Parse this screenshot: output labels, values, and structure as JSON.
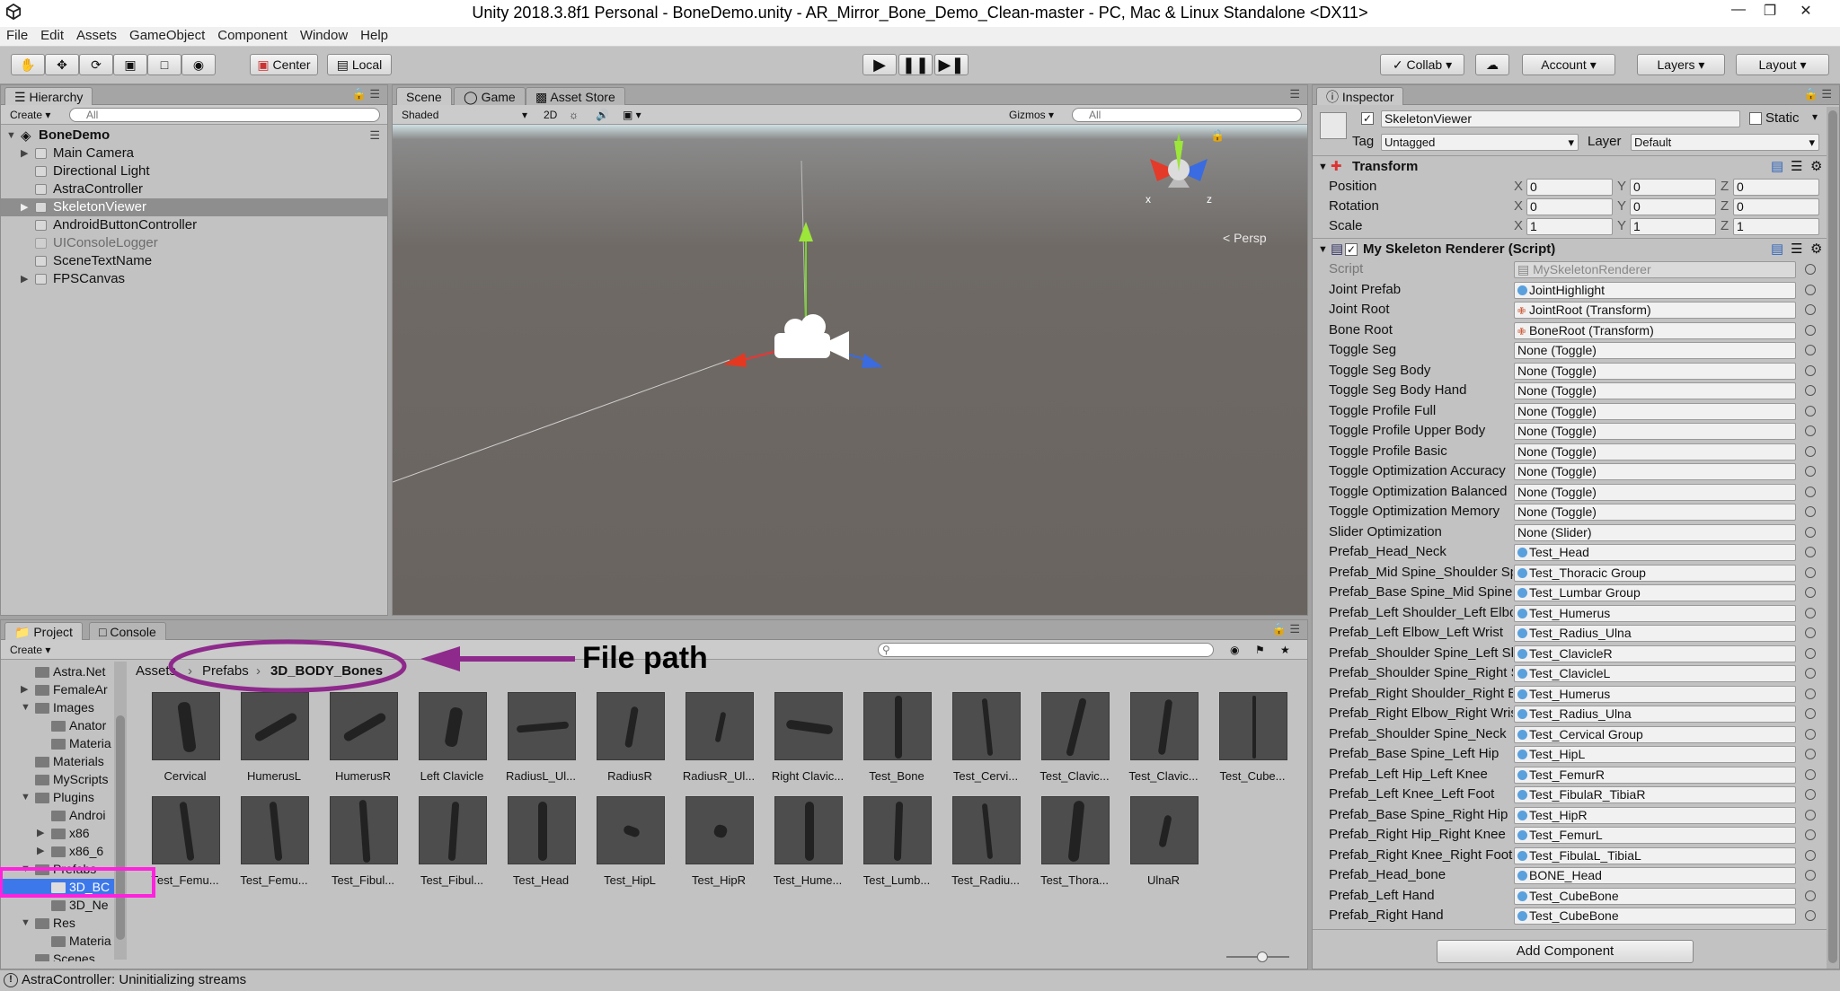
{
  "window": {
    "title": "Unity 2018.3.8f1 Personal - BoneDemo.unity - AR_Mirror_Bone_Demo_Clean-master - PC, Mac & Linux Standalone <DX11>"
  },
  "menu": [
    "File",
    "Edit",
    "Assets",
    "GameObject",
    "Component",
    "Window",
    "Help"
  ],
  "toolbar": {
    "center": "Center",
    "local": "Local",
    "collab": "Collab",
    "account": "Account",
    "layers": "Layers",
    "layout": "Layout"
  },
  "hierarchy": {
    "tab": "Hierarchy",
    "create": "Create",
    "search_placeholder": "All",
    "scene": "BoneDemo",
    "items": [
      {
        "label": "Main Camera"
      },
      {
        "label": "Directional Light"
      },
      {
        "label": "AstraController"
      },
      {
        "label": "SkeletonViewer"
      },
      {
        "label": "AndroidButtonController"
      },
      {
        "label": "UIConsoleLogger"
      },
      {
        "label": "SceneTextName"
      },
      {
        "label": "FPSCanvas"
      }
    ]
  },
  "scene": {
    "tabs": [
      "Scene",
      "Game",
      "Asset Store"
    ],
    "shading": "Shaded",
    "mode_2d": "2D",
    "gizmos": "Gizmos",
    "search_placeholder": "All",
    "persp": "Persp",
    "axis_x": "x",
    "axis_z": "z"
  },
  "inspector": {
    "tab": "Inspector",
    "object_name": "SkeletonViewer",
    "static": "Static",
    "tag_label": "Tag",
    "tag": "Untagged",
    "layer_label": "Layer",
    "layer": "Default",
    "transform": {
      "title": "Transform",
      "rows": [
        {
          "label": "Position",
          "x": "0",
          "y": "0",
          "z": "0"
        },
        {
          "label": "Rotation",
          "x": "0",
          "y": "0",
          "z": "0"
        },
        {
          "label": "Scale",
          "x": "1",
          "y": "1",
          "z": "1"
        }
      ],
      "axis_labels": [
        "X",
        "Y",
        "Z"
      ]
    },
    "script_component": {
      "title": "My Skeleton Renderer (Script)",
      "fields": [
        {
          "label": "Script",
          "value": "MySkeletonRenderer",
          "kind": "script"
        },
        {
          "label": "Joint Prefab",
          "value": "JointHighlight",
          "kind": "obj"
        },
        {
          "label": "Joint Root",
          "value": "JointRoot (Transform)",
          "kind": "transform"
        },
        {
          "label": "Bone Root",
          "value": "BoneRoot (Transform)",
          "kind": "transform"
        },
        {
          "label": "Toggle Seg",
          "value": "None (Toggle)",
          "kind": "none"
        },
        {
          "label": "Toggle Seg Body",
          "value": "None (Toggle)",
          "kind": "none"
        },
        {
          "label": "Toggle Seg Body Hand",
          "value": "None (Toggle)",
          "kind": "none"
        },
        {
          "label": "Toggle Profile Full",
          "value": "None (Toggle)",
          "kind": "none"
        },
        {
          "label": "Toggle Profile Upper Body",
          "value": "None (Toggle)",
          "kind": "none"
        },
        {
          "label": "Toggle Profile Basic",
          "value": "None (Toggle)",
          "kind": "none"
        },
        {
          "label": "Toggle Optimization Accuracy",
          "value": "None (Toggle)",
          "kind": "none"
        },
        {
          "label": "Toggle Optimization Balanced",
          "value": "None (Toggle)",
          "kind": "none"
        },
        {
          "label": "Toggle Optimization Memory",
          "value": "None (Toggle)",
          "kind": "none"
        },
        {
          "label": "Slider Optimization",
          "value": "None (Slider)",
          "kind": "none"
        },
        {
          "label": "Prefab_Head_Neck",
          "value": "Test_Head",
          "kind": "obj"
        },
        {
          "label": "Prefab_Mid Spine_Shoulder Spine",
          "value": "Test_Thoracic Group",
          "kind": "obj"
        },
        {
          "label": "Prefab_Base Spine_Mid Spine",
          "value": "Test_Lumbar Group",
          "kind": "obj"
        },
        {
          "label": "Prefab_Left Shoulder_Left Elbow",
          "value": "Test_Humerus",
          "kind": "obj"
        },
        {
          "label": "Prefab_Left Elbow_Left Wrist",
          "value": "Test_Radius_Ulna",
          "kind": "obj"
        },
        {
          "label": "Prefab_Shoulder Spine_Left Shoulder",
          "value": "Test_ClavicleR",
          "kind": "obj"
        },
        {
          "label": "Prefab_Shoulder Spine_Right Shoulder",
          "value": "Test_ClavicleL",
          "kind": "obj"
        },
        {
          "label": "Prefab_Right Shoulder_Right Elbow",
          "value": "Test_Humerus",
          "kind": "obj"
        },
        {
          "label": "Prefab_Right Elbow_Right Wrist",
          "value": "Test_Radius_Ulna",
          "kind": "obj"
        },
        {
          "label": "Prefab_Shoulder Spine_Neck",
          "value": "Test_Cervical Group",
          "kind": "obj"
        },
        {
          "label": "Prefab_Base Spine_Left Hip",
          "value": "Test_HipL",
          "kind": "obj"
        },
        {
          "label": "Prefab_Left Hip_Left Knee",
          "value": "Test_FemurR",
          "kind": "obj"
        },
        {
          "label": "Prefab_Left Knee_Left Foot",
          "value": "Test_FibulaR_TibiaR",
          "kind": "obj"
        },
        {
          "label": "Prefab_Base Spine_Right Hip",
          "value": "Test_HipR",
          "kind": "obj"
        },
        {
          "label": "Prefab_Right Hip_Right Knee",
          "value": "Test_FemurL",
          "kind": "obj"
        },
        {
          "label": "Prefab_Right Knee_Right Foot",
          "value": "Test_FibulaL_TibiaL",
          "kind": "obj"
        },
        {
          "label": "Prefab_Head_bone",
          "value": "BONE_Head",
          "kind": "obj"
        },
        {
          "label": "Prefab_Left Hand",
          "value": "Test_CubeBone",
          "kind": "obj"
        },
        {
          "label": "Prefab_Right Hand",
          "value": "Test_CubeBone",
          "kind": "obj"
        }
      ]
    },
    "add_component": "Add Component"
  },
  "project": {
    "tabs": [
      "Project",
      "Console"
    ],
    "create": "Create",
    "breadcrumb": [
      "Assets",
      "Prefabs",
      "3D_BODY_Bones"
    ],
    "annotation": "File path",
    "tree": [
      {
        "label": "Astra.Net"
      },
      {
        "label": "FemaleAr"
      },
      {
        "label": "Images"
      },
      {
        "label": "Anator"
      },
      {
        "label": "Materia"
      },
      {
        "label": "Materials"
      },
      {
        "label": "MyScripts"
      },
      {
        "label": "Plugins"
      },
      {
        "label": "Androi"
      },
      {
        "label": "x86"
      },
      {
        "label": "x86_6"
      },
      {
        "label": "Prefabs"
      },
      {
        "label": "3D_BC"
      },
      {
        "label": "3D_Ne"
      },
      {
        "label": "Res"
      },
      {
        "label": "Materia"
      },
      {
        "label": "Scenes"
      }
    ],
    "assets_row1": [
      "Cervical",
      "HumerusL",
      "HumerusR",
      "Left Clavicle",
      "RadiusL_Ul...",
      "RadiusR",
      "RadiusR_Ul...",
      "Right Clavic...",
      "Test_Bone",
      "Test_Cervi...",
      "Test_Clavic...",
      "Test_Clavic...",
      "Test_Cube..."
    ],
    "assets_row2": [
      "Test_Femu...",
      "Test_Femu...",
      "Test_Fibul...",
      "Test_Fibul...",
      "Test_Head",
      "Test_HipL",
      "Test_HipR",
      "Test_Hume...",
      "Test_Lumb...",
      "Test_Radiu...",
      "Test_Thora...",
      "UlnaR"
    ]
  },
  "status": {
    "message": "AstraController: Uninitializing streams"
  },
  "colors": {
    "annotation_purple": "#8e2a8c",
    "annotation_pink": "#ff22dd",
    "selection_blue": "#3c78ea"
  }
}
